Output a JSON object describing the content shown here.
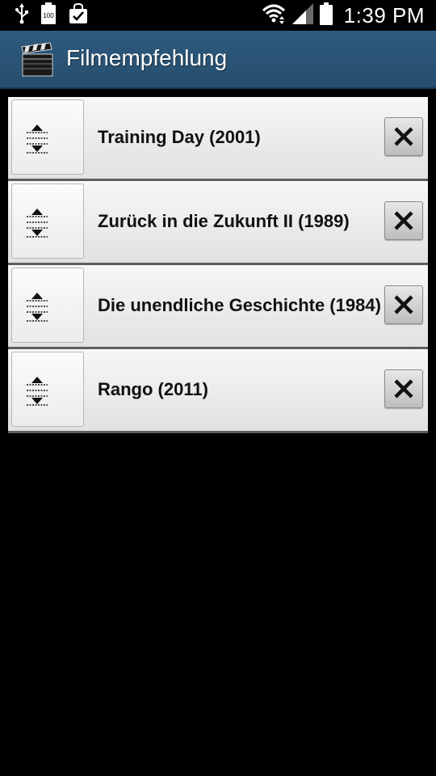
{
  "status_bar": {
    "time": "1:39 PM",
    "battery_level_text": "100",
    "icons": [
      "usb-icon",
      "battery-saver-icon",
      "shopping-bag-check-icon",
      "wifi-icon",
      "signal-icon",
      "battery-icon"
    ]
  },
  "app": {
    "title": "Filmempfehlung",
    "icon": "clapperboard-icon",
    "header_color": "#2b557a"
  },
  "movies": [
    {
      "title": "Training Day (2001)"
    },
    {
      "title": "Zurück in die Zukunft II (1989)"
    },
    {
      "title": "Die unendliche Geschichte (1984)"
    },
    {
      "title": "Rango (2011)"
    }
  ],
  "row_icons": {
    "handle": "drag-reorder-icon",
    "delete": "close-icon"
  }
}
